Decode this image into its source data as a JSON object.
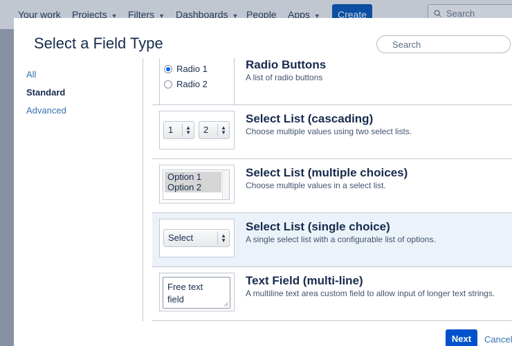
{
  "background_nav": {
    "items": [
      {
        "label": "Your work",
        "caret": false
      },
      {
        "label": "Projects",
        "caret": true
      },
      {
        "label": "Filters",
        "caret": true
      },
      {
        "label": "Dashboards",
        "caret": true
      },
      {
        "label": "People",
        "caret": false
      },
      {
        "label": "Apps",
        "caret": true
      }
    ],
    "create_label": "Create",
    "search_label": "Search"
  },
  "dialog": {
    "title": "Select a Field Type",
    "search_placeholder": "Search",
    "categories": [
      {
        "label": "All",
        "active": false
      },
      {
        "label": "Standard",
        "active": true
      },
      {
        "label": "Advanced",
        "active": false
      }
    ],
    "fields": [
      {
        "name": "Radio Buttons",
        "description": "A list of radio buttons",
        "preview": {
          "type": "radio",
          "options": [
            "Radio 1",
            "Radio 2"
          ],
          "checked_index": 0
        },
        "selected": false
      },
      {
        "name": "Select List (cascading)",
        "description": "Choose multiple values using two select lists.",
        "preview": {
          "type": "cascading",
          "values": [
            "1",
            "2"
          ]
        },
        "selected": false
      },
      {
        "name": "Select List (multiple choices)",
        "description": "Choose multiple values in a select list.",
        "preview": {
          "type": "multi",
          "options": [
            "Option 1",
            "Option 2"
          ]
        },
        "selected": false
      },
      {
        "name": "Select List (single choice)",
        "description": "A single select list with a configurable list of options.",
        "preview": {
          "type": "single",
          "value": "Select"
        },
        "selected": true
      },
      {
        "name": "Text Field (multi-line)",
        "description": "A multiline text area custom field to allow input of longer text strings.",
        "preview": {
          "type": "textarea",
          "lines": [
            "Free text",
            "field"
          ]
        },
        "selected": false
      }
    ],
    "next_label": "Next",
    "cancel_label": "Cancel"
  },
  "colors": {
    "primary_button": "#0052cc",
    "link": "#3572b0",
    "selected_row": "#ebf2f9",
    "heading": "#172b4d"
  }
}
